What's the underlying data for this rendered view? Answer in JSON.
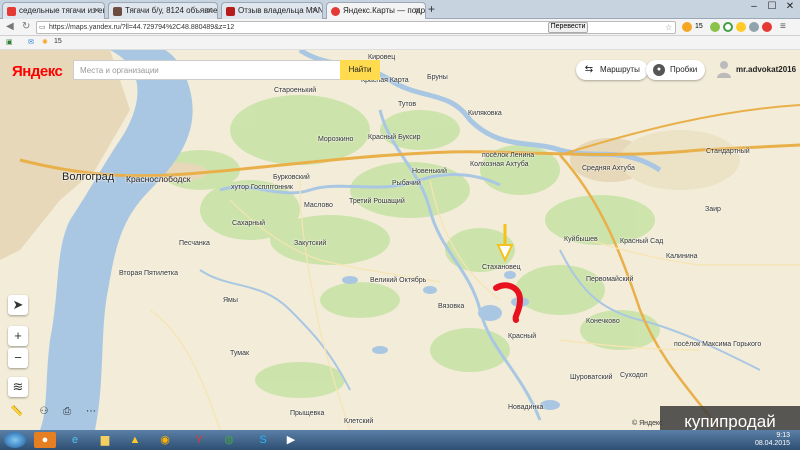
{
  "browser": {
    "tabs": [
      {
        "label": "седельные тягачи из евро…",
        "color": "#e53935"
      },
      {
        "label": "Тягачи б/у, 8124 объявле…",
        "color": "#6d4c41"
      },
      {
        "label": "Отзыв владельца MAN 18.…",
        "color": "#b71c1c"
      },
      {
        "label": "Яндекс.Карты — подробн…",
        "color": "#e53935"
      }
    ],
    "new_tab": "+",
    "url": "https://maps.yandex.ru/?ll=44.729794%2C48.880489&z=12",
    "translate_label": "Перевести",
    "bookmark_count": "15",
    "ext_count": "15"
  },
  "map": {
    "logo": "Яндекс",
    "search_placeholder": "Места и организации",
    "search_button": "Найти",
    "routes_label": "Маршруты",
    "traffic_label": "Пробки",
    "user_name": "mr.advokat2016",
    "copyright": "© Яндекс",
    "zoom_in": "+",
    "zoom_out": "−",
    "labels": {
      "volgograd": "Волгоград",
      "krasnoslobodsk": "Краснослободск",
      "kirovets": "Кировец",
      "krasnaya_karta": "Красная Карта",
      "bruny": "Бруны",
      "starenkiy": "Староенький",
      "tutov": "Тутов",
      "kilyakovka": "Киляковка",
      "morozkino": "Морозкино",
      "krasny_buksir": "Красный Буксир",
      "poselok_lenina": "посёлок Ленина",
      "srednyaya_akhtuba": "Средняя Ахтуба",
      "burkovsky": "Бурковский",
      "novenkiy": "Новенький",
      "kolkhoznaya": "Колхозная Ахтуба",
      "khutor": "хутор Госплггонник",
      "rybachiy": "Рыбачий",
      "standartny": "Стандартный",
      "maslovo": "Маслово",
      "tretyi": "Третий Рошащий",
      "zair": "Заир",
      "sakharny": "Сахарный",
      "kuybyshev": "Куйбышев",
      "krasny_sad": "Красный Сад",
      "pesmachanka": "Песчанка",
      "zakutsky": "Закутский",
      "kalinina": "Калинина",
      "vtoraya": "Вторая Пятилетка",
      "stakhanovets": "Стахановец",
      "pervomaysky": "Первомайский",
      "velikiy": "Великий Октябрь",
      "vyazovka": "Вязовка",
      "yamy": "Ямы",
      "konetskovo": "Конечково",
      "krasny": "Красный",
      "poselok_gorkogo": "посёлок Максима Горького",
      "tumak": "Тумак",
      "shurovatskiy": "Шуроватский",
      "sukhodol": "Суходол",
      "pryshchevka": "Прыщевка",
      "novadinka": "Новадинка",
      "kletsky": "Клетский"
    }
  },
  "watermark": "купипродай",
  "taskbar": {
    "time": "9:13",
    "date": "08.04.2015"
  }
}
